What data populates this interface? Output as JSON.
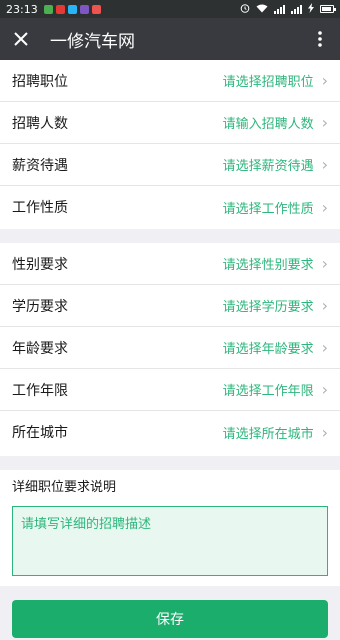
{
  "status_bar": {
    "time": "23:13",
    "battery_level": 0.85,
    "notification_colors": [
      "#4caf50",
      "#e53935",
      "#29b6f6",
      "#7e57c2",
      "#ef5350"
    ]
  },
  "app_bar": {
    "title": "一修汽车网",
    "close_icon": "close-icon",
    "more_icon": "more-vertical-icon"
  },
  "job_group": [
    {
      "label": "招聘职位",
      "value": "请选择招聘职位"
    },
    {
      "label": "招聘人数",
      "value": "请输入招聘人数"
    },
    {
      "label": "薪资待遇",
      "value": "请选择薪资待遇"
    },
    {
      "label": "工作性质",
      "value": "请选择工作性质"
    }
  ],
  "requirement_group": [
    {
      "label": "性别要求",
      "value": "请选择性别要求"
    },
    {
      "label": "学历要求",
      "value": "请选择学历要求"
    },
    {
      "label": "年龄要求",
      "value": "请选择年龄要求"
    },
    {
      "label": "工作年限",
      "value": "请选择工作年限"
    },
    {
      "label": "所在城市",
      "value": "请选择所在城市"
    }
  ],
  "description": {
    "title": "详细职位要求说明",
    "placeholder": "请填写详细的招聘描述"
  },
  "footer": {
    "save_label": "保存"
  },
  "colors": {
    "accent": "#2db67c",
    "button": "#1aad6b",
    "app_bar": "#393a3f"
  }
}
